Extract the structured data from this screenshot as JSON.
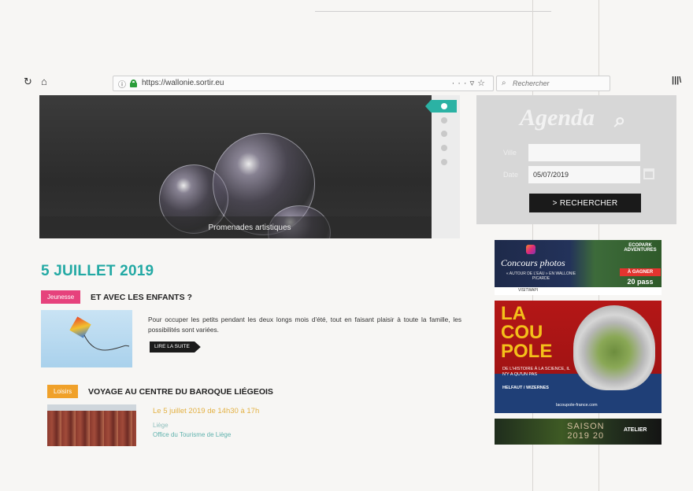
{
  "browser": {
    "url": "https://wallonie.sortir.eu",
    "search_placeholder": "Rechercher",
    "icons": [
      "reload-icon",
      "home-icon",
      "info-icon",
      "lock-icon",
      "page-actions-icon",
      "pocket-icon",
      "bookmark-star-icon",
      "search-icon",
      "library-icon"
    ]
  },
  "hero": {
    "caption": "Promenades artistiques",
    "slides_count": 5,
    "active_slide": 1
  },
  "agenda": {
    "title": "Agenda",
    "where_label": "Ville",
    "date_label": "Date",
    "where_value": "",
    "date_value": "05/07/2019",
    "search_button": "> RECHERCHER"
  },
  "main": {
    "date_heading": "5 JUILLET 2019",
    "articles": [
      {
        "category": "Jeunesse",
        "title": "ET AVEC LES ENFANTS ?",
        "text": "Pour occuper les petits pendant les deux longs mois d'été, tout en faisant plaisir à toute la famille, les possibilités sont variées.",
        "read_more": "LIRE LA SUITE"
      },
      {
        "category": "Loisirs",
        "title": "VOYAGE AU CENTRE DU BAROQUE LIÉGEOIS",
        "date": "Le 5 juillet 2019 de 14h30 à 17h",
        "city": "Liège",
        "organizer": "Office du Tourisme de Liège"
      }
    ]
  },
  "ads": {
    "ad1": {
      "title": "Concours photos",
      "subtitle": "« AUTOUR DE L'EAU » EN WALLONIE PICARDE",
      "brand": "ECOPARK ADVENTURES",
      "win": "À GAGNER",
      "prize": "20 pass",
      "sponsor": "VISITWAPI"
    },
    "ad2": {
      "line1": "LA",
      "line2": "COU",
      "line3": "POLE",
      "tagline": "DE L'HISTOIRE À LA SCIENCE, IL N'Y A QU'UN PAS",
      "place": "HELFAUT / WIZERNES",
      "url": "lacoupole-france.com"
    },
    "ad3": {
      "season_line1": "SAISON",
      "season_line2": "2019 20",
      "brand": "ATELIER"
    }
  }
}
